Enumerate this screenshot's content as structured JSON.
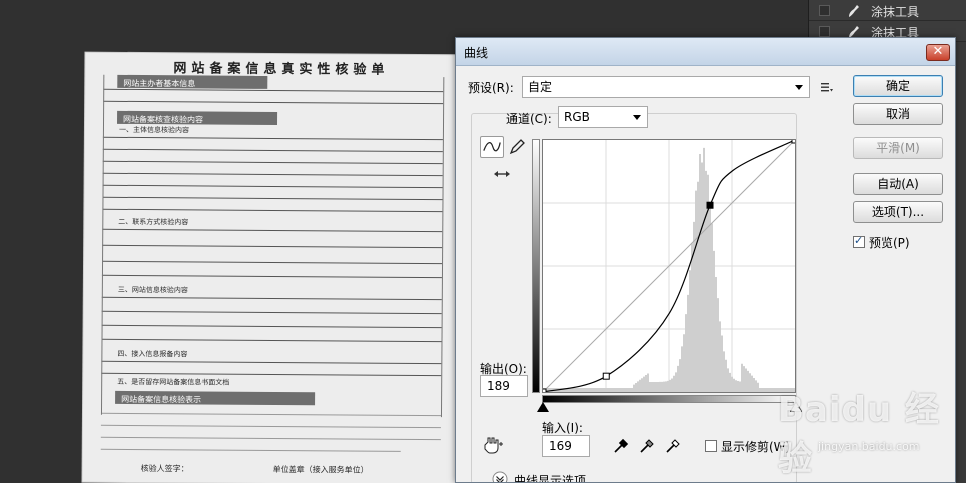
{
  "layers_panel": {
    "rows": [
      {
        "name": "涂抹工具"
      },
      {
        "name": "涂抹工具"
      }
    ]
  },
  "background_doc": {
    "title": "网站备案信息真实性核验单",
    "sections": [
      "网站主办者基本信息",
      "网站备案核查核验内容",
      "一、主体信息核验内容",
      "二、联系方式核验内容",
      "三、网站信息核验内容",
      "四、接入信息报备内容",
      "五、是否留存网站备案信息书面文档",
      "网站备案信息核验表示"
    ],
    "footer_left": "核验人签字：",
    "footer_right": "单位盖章（接入服务单位）"
  },
  "dialog": {
    "title": "曲线",
    "close_label": "✕",
    "preset_label": "预设(R):",
    "preset_value": "自定",
    "channel_label": "通道(C):",
    "channel_value": "RGB",
    "output_label": "输出(O):",
    "output_value": "189",
    "input_label": "输入(I):",
    "input_value": "169",
    "show_clipping_label": "显示修剪(W)",
    "curve_display_options_label": "曲线显示选项",
    "buttons": {
      "ok": "确定",
      "cancel": "取消",
      "smooth": "平滑(M)",
      "auto": "自动(A)",
      "options": "选项(T)...",
      "preview": "预览(P)"
    }
  },
  "curve": {
    "type": "line",
    "x": [
      0,
      64,
      128,
      169,
      192,
      255
    ],
    "y": [
      0,
      16,
      80,
      189,
      224,
      255
    ],
    "xlim": [
      0,
      255
    ],
    "ylim": [
      0,
      255
    ],
    "selected_point": {
      "x": 169,
      "y": 189
    }
  },
  "watermark": {
    "brand": "Baidu 经验",
    "domain": "jingyan.baidu.com"
  }
}
